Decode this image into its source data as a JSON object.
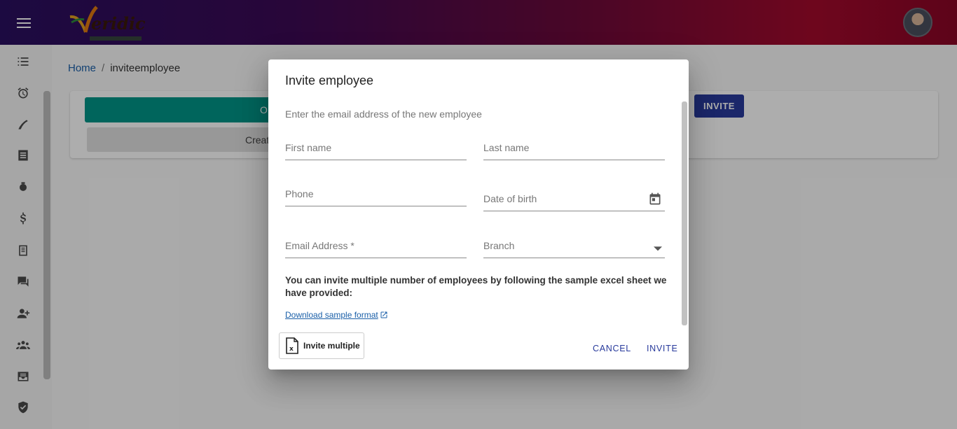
{
  "app": {
    "logo_text": "Veridic",
    "logo_subtext": "SOLUTIONS"
  },
  "breadcrumb": {
    "home": "Home",
    "separator": "/",
    "current": "inviteemployee"
  },
  "background": {
    "green_button_label": "O",
    "grey_button_label": "Creat",
    "invite_button_label": "INVITE"
  },
  "sidebar": {
    "items": [
      {
        "icon": "checklist-icon"
      },
      {
        "icon": "alarm-icon"
      },
      {
        "icon": "flight-icon"
      },
      {
        "icon": "list-icon"
      },
      {
        "icon": "bug-icon"
      },
      {
        "icon": "dollar-icon"
      },
      {
        "icon": "notes-icon"
      },
      {
        "icon": "chat-icon"
      },
      {
        "icon": "person-add-icon"
      },
      {
        "icon": "group-icon"
      },
      {
        "icon": "inbox-icon"
      },
      {
        "icon": "verified-icon"
      }
    ]
  },
  "dialog": {
    "title": "Invite employee",
    "subtitle": "Enter the email address of the new employee",
    "fields": {
      "first_name": {
        "placeholder": "First name",
        "value": ""
      },
      "last_name": {
        "placeholder": "Last name",
        "value": ""
      },
      "phone": {
        "placeholder": "Phone",
        "value": ""
      },
      "dob": {
        "placeholder": "Date of birth",
        "value": ""
      },
      "email": {
        "placeholder": "Email Address *",
        "value": ""
      },
      "branch": {
        "placeholder": "Branch",
        "value": ""
      }
    },
    "info_text": "You can invite multiple number of employees by following the sample excel sheet we have provided:",
    "download_link": "Download sample format",
    "invite_multiple_label": "Invite multiple",
    "cancel_label": "CANCEL",
    "invite_label": "INVITE"
  },
  "colors": {
    "primary": "#283a9c",
    "teal": "#009688",
    "link": "#1a5fa8"
  }
}
